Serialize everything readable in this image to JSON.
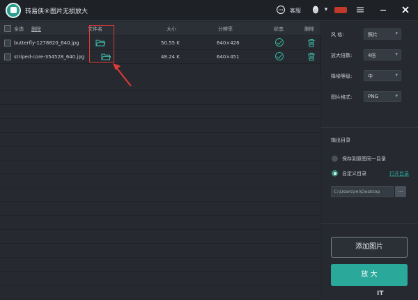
{
  "app": {
    "title": "转易侠®图片无损放大",
    "support": "客服"
  },
  "table": {
    "select_all": "全选",
    "delete_link": "删除",
    "headers": {
      "filename": "文件名",
      "size": "大小",
      "resolution": "分辨率",
      "status": "状态",
      "delete": "删除"
    },
    "rows": [
      {
        "name": "butterfly-1278820_640.jpg",
        "size": "50.55 K",
        "resolution": "640×426"
      },
      {
        "name": "striped-core-354528_640.jpg",
        "size": "48.24 K",
        "resolution": "640×451"
      }
    ]
  },
  "settings": {
    "style_label": "风    格:",
    "style_value": "照片",
    "scale_label": "放大倍数:",
    "scale_value": "4倍",
    "denoise_label": "降噪等级:",
    "denoise_value": "中",
    "format_label": "图片格式:",
    "format_value": "PNG"
  },
  "output": {
    "title": "输出目录",
    "option_same": "保存到原图同一目录",
    "option_custom": "自定义目录",
    "open_dir": "打开目录",
    "path": "C:\\Users\\mi\\Desktop",
    "browse": "..."
  },
  "buttons": {
    "add": "添加图片",
    "zoom": "放  大"
  },
  "watermark": "IT"
}
